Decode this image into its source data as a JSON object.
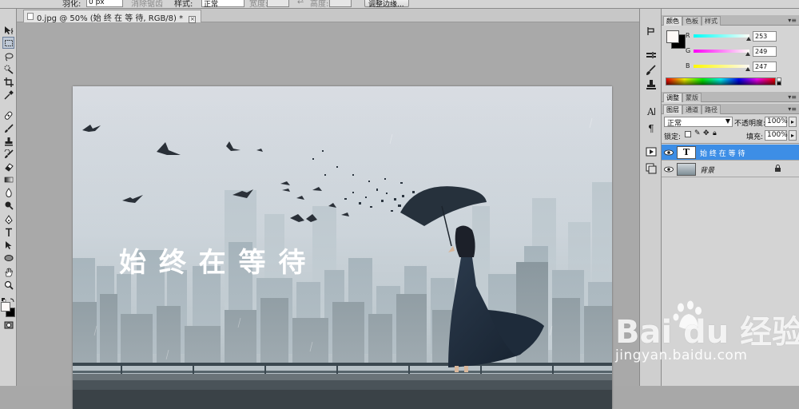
{
  "options_bar": {
    "feather_label": "羽化:",
    "feather_value": "0 px",
    "antialias_label": "消除锯齿",
    "style_label": "样式:",
    "style_value": "正常",
    "width_label": "宽度:",
    "height_label": "高度:",
    "refine_edge_button": "调整边缘..."
  },
  "document_tab": {
    "title": "0.jpg @ 50% (始 终 在 等 待, RGB/8) *",
    "close_glyph": "×"
  },
  "canvas_text": "始 终 在 等 待",
  "color_panel": {
    "tabs": [
      "颜色",
      "色板",
      "样式"
    ],
    "active_tab": 0,
    "channels": [
      {
        "label": "R",
        "value": "253",
        "level": 0.992,
        "color_start": "#00fdf7",
        "color_end": "#fdfdf7"
      },
      {
        "label": "G",
        "value": "249",
        "level": 0.976,
        "color_start": "#fd00f7",
        "color_end": "#fdfdf7"
      },
      {
        "label": "B",
        "value": "247",
        "level": 0.969,
        "color_start": "#fdf900",
        "color_end": "#fdf9f7"
      }
    ]
  },
  "adjust_panel": {
    "tabs": [
      "调整",
      "蒙版"
    ],
    "active_tab": 0
  },
  "layers_panel": {
    "tabs": [
      "图层",
      "通道",
      "路径"
    ],
    "active_tab": 0,
    "blend_mode": "正常",
    "opacity_label": "不透明度:",
    "opacity_value": "100%",
    "lock_label": "锁定:",
    "fill_label": "填充:",
    "fill_value": "100%",
    "layers": [
      {
        "name": "始 终 在 等 待",
        "type": "text",
        "thumb_glyph": "T",
        "selected": true
      },
      {
        "name": "背景",
        "type": "image",
        "locked": true,
        "selected": false
      }
    ]
  },
  "watermark": {
    "logo": "Bai du 经验",
    "url": "jingyan.baidu.com"
  },
  "colors": {
    "selection_blue": "#3d8ee6",
    "panel_bg": "#d4d4d4",
    "canvas_bg": "#a9a9a9"
  }
}
